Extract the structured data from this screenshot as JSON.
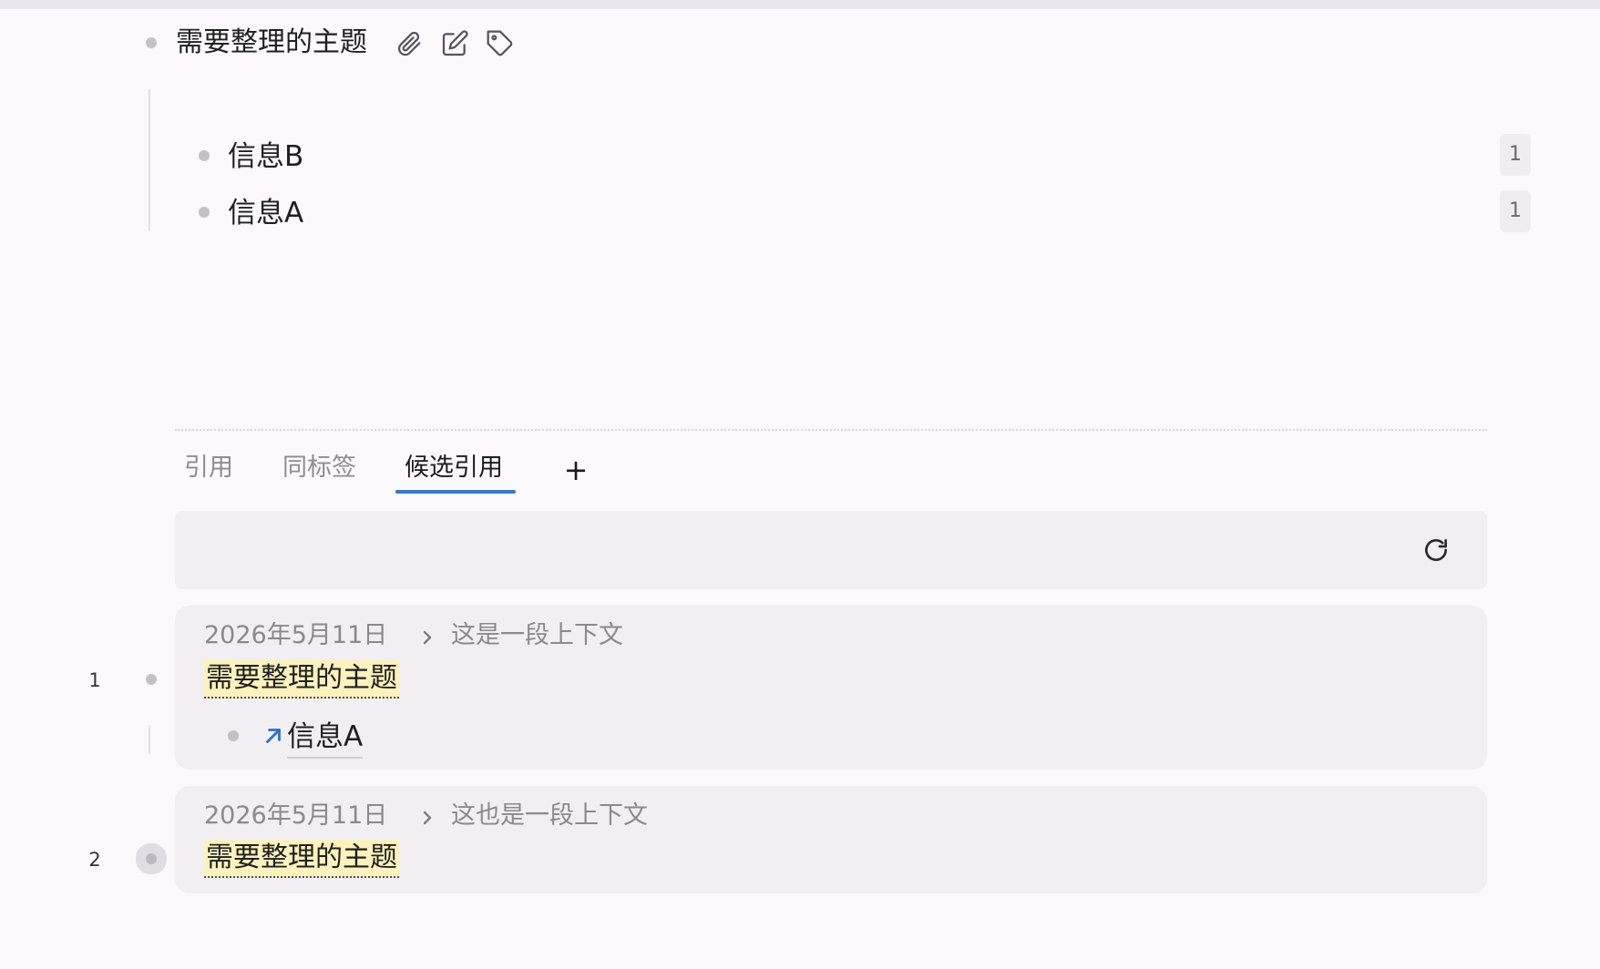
{
  "root": {
    "title": "需要整理的主题",
    "icons": [
      "paperclip-icon",
      "edit-icon",
      "tag-icon"
    ]
  },
  "children": [
    {
      "label": "信息B",
      "ref_count": "1"
    },
    {
      "label": "信息A",
      "ref_count": "1"
    }
  ],
  "tabs": {
    "items": [
      "引用",
      "同标签",
      "候选引用"
    ],
    "active_index": 2,
    "add_label": "+"
  },
  "toolbar": {
    "refresh_icon": "refresh-icon"
  },
  "results": [
    {
      "index": "1",
      "date": "2026年5月11日",
      "context": "这是一段上下文",
      "match": "需要整理的主题",
      "child_ref": "信息A"
    },
    {
      "index": "2",
      "date": "2026年5月11日",
      "context": "这也是一段上下文",
      "match": "需要整理的主题"
    }
  ],
  "colors": {
    "accent": "#3a76c9",
    "highlight": "#fdf2bd",
    "background": "#fbf9fc",
    "card": "#f1eff2"
  }
}
